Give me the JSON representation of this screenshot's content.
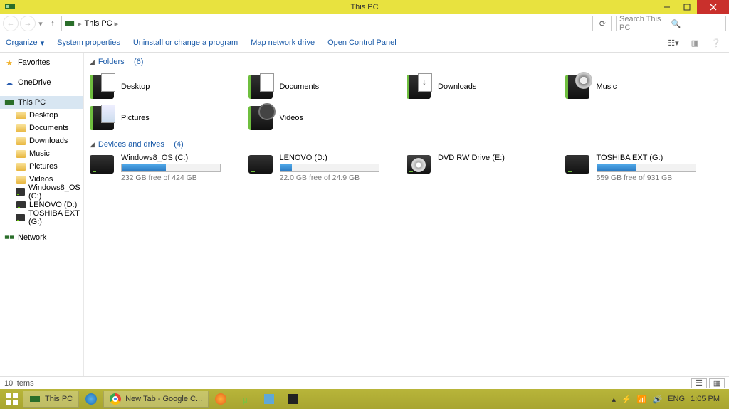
{
  "window": {
    "title": "This PC"
  },
  "address": {
    "location": "This PC"
  },
  "search": {
    "placeholder": "Search This PC"
  },
  "toolbar": {
    "organize": "Organize",
    "sys_props": "System properties",
    "uninstall": "Uninstall or change a program",
    "map_drive": "Map network drive",
    "ctrl_panel": "Open Control Panel"
  },
  "sidebar": {
    "favorites": "Favorites",
    "onedrive": "OneDrive",
    "thispc": "This PC",
    "children": [
      "Desktop",
      "Documents",
      "Downloads",
      "Music",
      "Pictures",
      "Videos",
      "Windows8_OS (C:)",
      "LENOVO (D:)",
      "TOSHIBA EXT (G:)"
    ],
    "network": "Network"
  },
  "sections": {
    "folders": {
      "label": "Folders",
      "count": "(6)"
    },
    "drives": {
      "label": "Devices and drives",
      "count": "(4)"
    }
  },
  "folders": [
    "Desktop",
    "Documents",
    "Downloads",
    "Music",
    "Pictures",
    "Videos"
  ],
  "drives": [
    {
      "name": "Windows8_OS (C:)",
      "free": "232 GB free of 424 GB",
      "pct": 45
    },
    {
      "name": "LENOVO (D:)",
      "free": "22.0 GB free of 24.9 GB",
      "pct": 12
    },
    {
      "name": "DVD RW Drive (E:)",
      "free": "",
      "pct": null
    },
    {
      "name": "TOSHIBA EXT (G:)",
      "free": "559 GB free of 931 GB",
      "pct": 40
    }
  ],
  "status": {
    "items": "10 items"
  },
  "taskbar": {
    "items": [
      {
        "label": "This PC",
        "icon": "pc"
      },
      {
        "label": "",
        "icon": "ie"
      },
      {
        "label": "New Tab - Google C...",
        "icon": "chrome"
      },
      {
        "label": "",
        "icon": "ff"
      },
      {
        "label": "",
        "icon": "ut"
      },
      {
        "label": "",
        "icon": "np"
      },
      {
        "label": "",
        "icon": "cmd"
      }
    ],
    "lang": "ENG",
    "time": "1:05 PM"
  }
}
